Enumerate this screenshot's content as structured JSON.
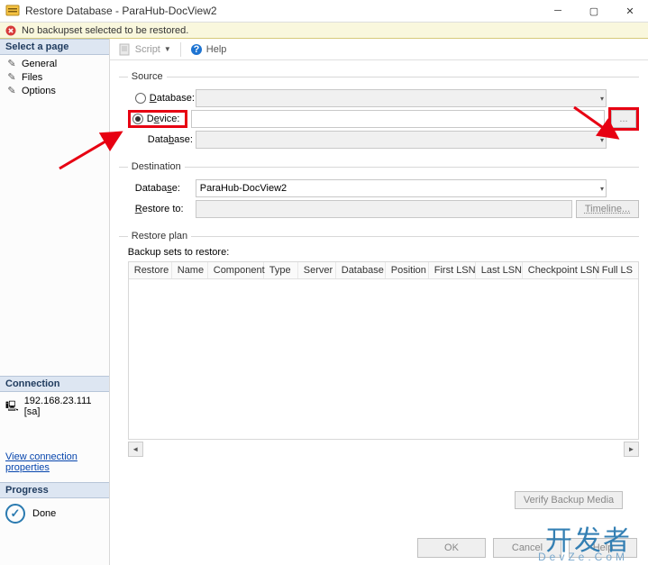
{
  "window": {
    "title": "Restore Database - ParaHub-DocView2"
  },
  "warning": "No backupset selected to be restored.",
  "sidebar": {
    "select_page": "Select a page",
    "pages": [
      "General",
      "Files",
      "Options"
    ],
    "connection_hdr": "Connection",
    "connection": "192.168.23.111 [sa]",
    "view_props": "View connection properties",
    "progress_hdr": "Progress",
    "progress_text": "Done"
  },
  "toolbar": {
    "script": "Script",
    "help": "Help"
  },
  "source": {
    "legend": "Source",
    "database_label": "Database:",
    "device_label": "Device:",
    "database2_label": "Database:",
    "device_path": "",
    "browse": "..."
  },
  "destination": {
    "legend": "Destination",
    "database_label": "Database:",
    "database_value": "ParaHub-DocView2",
    "restore_label": "Restore to:",
    "restore_value": "",
    "timeline": "Timeline..."
  },
  "restore_plan": {
    "legend": "Restore plan",
    "sets_label": "Backup sets to restore:",
    "columns": [
      "Restore",
      "Name",
      "Component",
      "Type",
      "Server",
      "Database",
      "Position",
      "First LSN",
      "Last LSN",
      "Checkpoint LSN",
      "Full LSN"
    ]
  },
  "buttons": {
    "verify": "Verify Backup Media",
    "ok": "OK",
    "cancel": "Cancel",
    "help": "Help"
  },
  "watermark": {
    "big": "开发者",
    "small": "DevZe.CoM"
  }
}
